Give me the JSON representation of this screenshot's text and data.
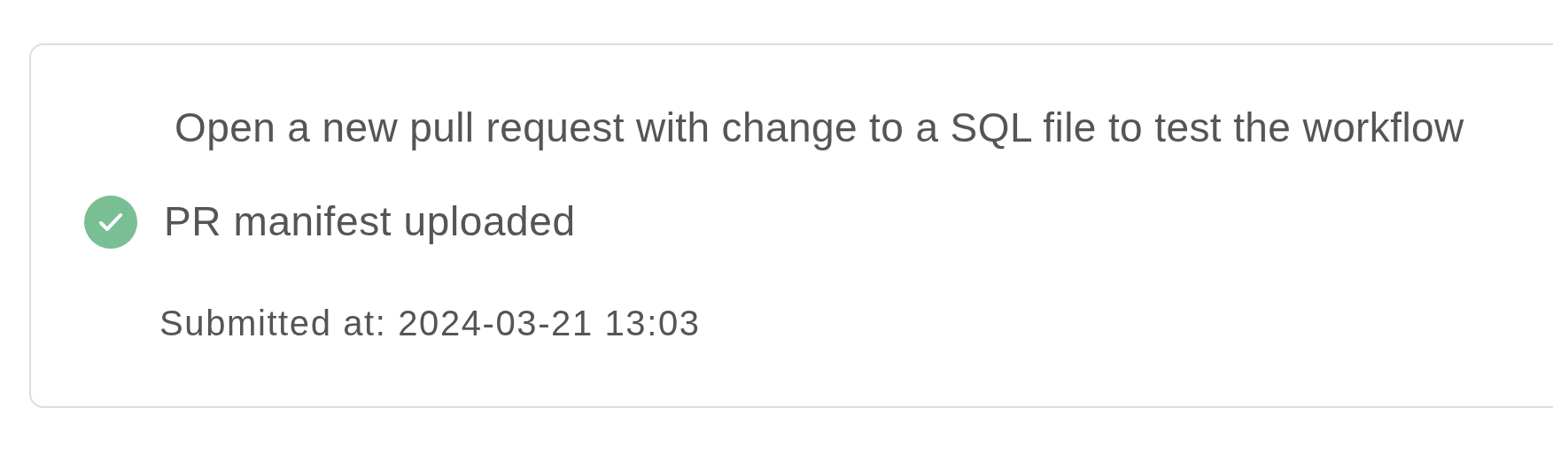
{
  "step": {
    "instruction": "Open a new pull request with change to a SQL file to test the workflow",
    "status": {
      "label": "PR manifest uploaded",
      "done": true
    },
    "submitted": "Submitted at: 2024-03-21 13:03"
  }
}
